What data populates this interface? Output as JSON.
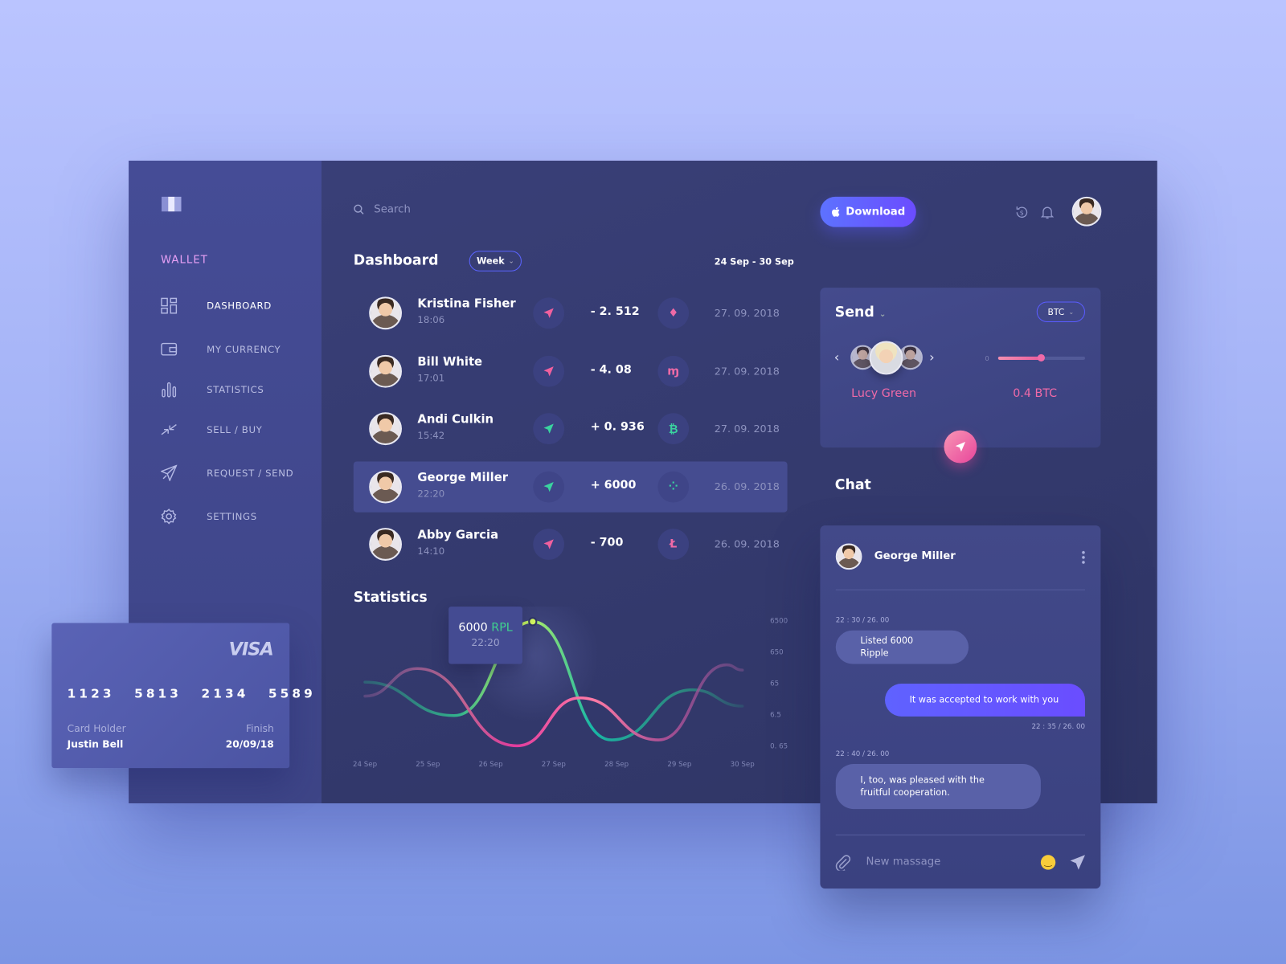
{
  "sidebar": {
    "section": "WALLET",
    "items": [
      {
        "label": "DASHBOARD",
        "icon": "grid-icon",
        "active": true
      },
      {
        "label": "MY CURRENCY",
        "icon": "wallet-icon"
      },
      {
        "label": "STATISTICS",
        "icon": "bar-chart-icon"
      },
      {
        "label": "SELL / BUY",
        "icon": "exchange-icon"
      },
      {
        "label": "REQUEST / SEND",
        "icon": "paper-plane-icon"
      },
      {
        "label": "SETTINGS",
        "icon": "gear-icon"
      }
    ]
  },
  "header": {
    "search_placeholder": "Search",
    "download_label": "Download"
  },
  "dashboard": {
    "title": "Dashboard",
    "period": "Week",
    "range": "24 Sep - 30 Sep",
    "transactions": [
      {
        "name": "Kristina Fisher",
        "time": "18:06",
        "direction": "sent",
        "amount": "- 2. 512",
        "coin": "ethereum",
        "date": "27. 09. 2018"
      },
      {
        "name": "Bill White",
        "time": "17:01",
        "direction": "sent",
        "amount": "- 4. 08",
        "coin": "monero",
        "date": "27. 09. 2018"
      },
      {
        "name": "Andi Culkin",
        "time": "15:42",
        "direction": "received",
        "amount": "+ 0. 936",
        "coin": "bitcoin",
        "date": "27. 09. 2018"
      },
      {
        "name": "George Miller",
        "time": "22:20",
        "direction": "received",
        "amount": "+ 6000",
        "coin": "ripple",
        "date": "26. 09. 2018",
        "selected": true
      },
      {
        "name": "Abby Garcia",
        "time": "14:10",
        "direction": "sent",
        "amount": "- 700",
        "coin": "litecoin",
        "date": "26. 09. 2018"
      }
    ]
  },
  "colors": {
    "sent": "#f0609e",
    "received": "#3ad29f",
    "accent": "#5b6cff",
    "pink": "#f06aa8"
  },
  "statistics": {
    "title": "Statistics",
    "tooltip": {
      "value": "6000",
      "unit": "RPL",
      "time": "22:20"
    }
  },
  "chart_data": {
    "type": "line",
    "title": "Statistics",
    "yscale": "log",
    "x_ticks": [
      "24 Sep",
      "25 Sep",
      "26 Sep",
      "27 Sep",
      "28 Sep",
      "29 Sep",
      "30 Sep"
    ],
    "y_ticks": [
      "6500",
      "650",
      "65",
      "6.5",
      "0. 65"
    ],
    "ylim": [
      0.65,
      6500
    ],
    "grid": false,
    "series": [
      {
        "color": "green-gradient",
        "points": [
          [
            "24 Sep 00:00",
            70
          ],
          [
            "25 Sep 10:00",
            6
          ],
          [
            "26 Sep 16:00",
            6000
          ],
          [
            "27 Sep 22:00",
            1
          ],
          [
            "29 Sep 05:00",
            40
          ],
          [
            "30 Sep 00:00",
            12
          ]
        ]
      },
      {
        "color": "pink-gradient",
        "points": [
          [
            "24 Sep 00:00",
            25
          ],
          [
            "24 Sep 20:00",
            190
          ],
          [
            "26 Sep 10:00",
            0.65
          ],
          [
            "27 Sep 10:00",
            22
          ],
          [
            "28 Sep 16:00",
            1
          ],
          [
            "29 Sep 18:00",
            250
          ],
          [
            "30 Sep 00:00",
            170
          ]
        ]
      }
    ]
  },
  "send": {
    "title": "Send",
    "currency": "BTC",
    "recipient": "Lucy Green",
    "amount": "0.4 BTC",
    "slider_min": "0",
    "slider_fraction": 0.5
  },
  "chat": {
    "title": "Chat",
    "contact": "George Miller",
    "messages": [
      {
        "from": "them",
        "time": "22 : 30 / 26. 00",
        "text": "Listed 6000 Ripple"
      },
      {
        "from": "me",
        "time": "22 : 35 / 26. 00",
        "text": "It was accepted to work with you"
      },
      {
        "from": "them",
        "time": "22 : 40 / 26. 00",
        "text": "I, too, was pleased with the fruitful cooperation."
      }
    ],
    "input_placeholder": "New massage"
  },
  "visa": {
    "brand": "VISA",
    "number": [
      "1123",
      "5813",
      "2134",
      "5589"
    ],
    "holder_label": "Card Holder",
    "holder": "Justin Bell",
    "finish_label": "Finish",
    "finish": "20/09/18"
  }
}
